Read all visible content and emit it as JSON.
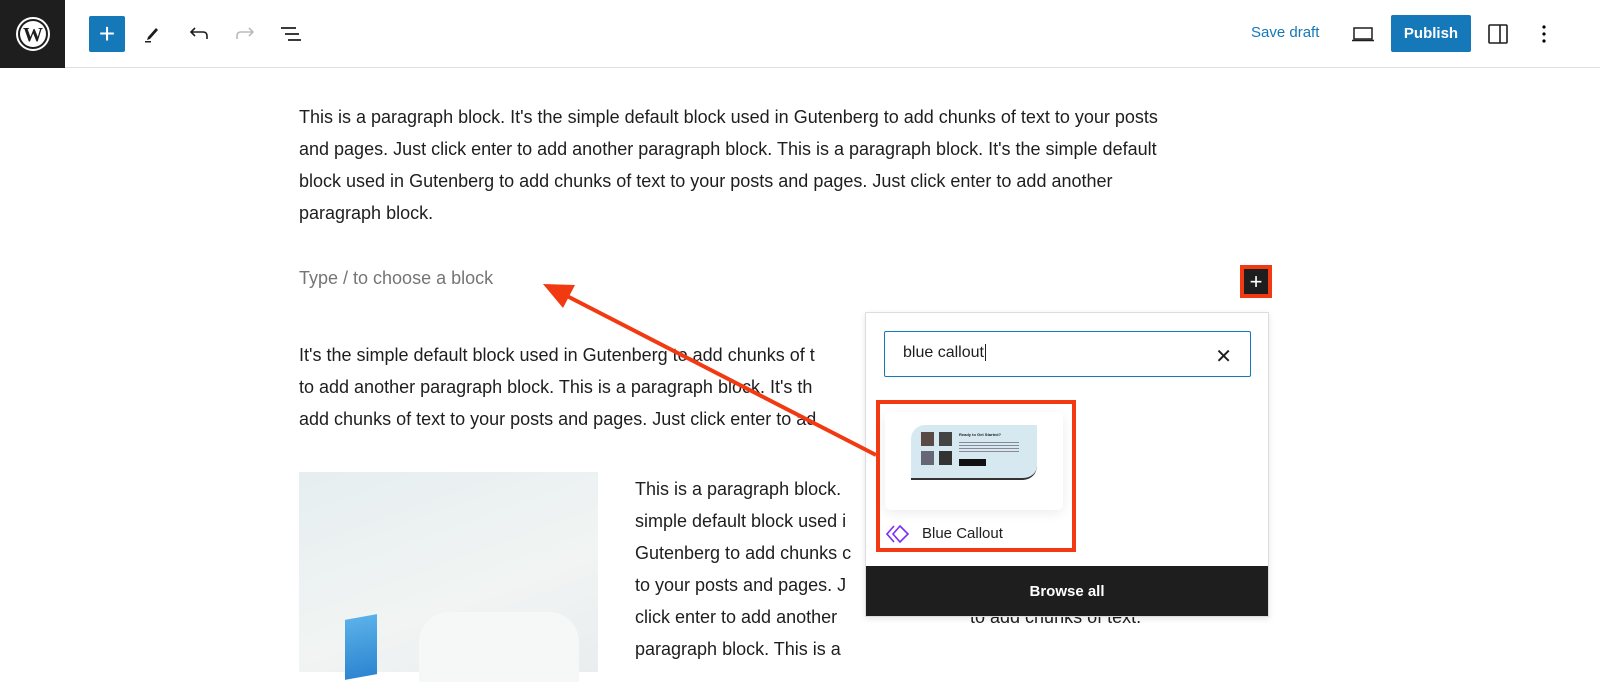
{
  "toolbar": {
    "save_draft": "Save draft",
    "publish": "Publish",
    "icons": [
      "wordpress-logo",
      "plus-icon",
      "pencil-icon",
      "undo-icon",
      "redo-icon",
      "list-view-icon",
      "laptop-preview-icon",
      "sidebar-icon",
      "more-vertical-icon"
    ]
  },
  "content": {
    "p1": [
      "This is a paragraph block. It's the simple default block used in Gutenberg to add chunks of text to your posts",
      "and pages. Just click enter to add another paragraph block. This is a paragraph block. It's the simple default",
      "block used in Gutenberg to add chunks of text to your posts and pages. Just click enter to add another",
      "paragraph block."
    ],
    "placeholder": "Type / to choose a block",
    "p2": [
      "It's the simple default block used in Gutenberg to add chunks of t",
      "to add another paragraph block. This is a paragraph block. It's th",
      "add chunks of text to your posts and pages. Just click enter to ad"
    ],
    "col_left": [
      "This is a paragraph block.",
      "simple default block used i",
      "Gutenberg to add chunks c",
      "to your posts and pages. J",
      "click enter to add another",
      "paragraph block. This is a"
    ],
    "col_right": "to add chunks of text."
  },
  "inserter": {
    "search_value": "blue callout",
    "result_label": "Blue Callout",
    "preview_title": "Ready to Get Started?",
    "browse_all": "Browse all"
  },
  "colors": {
    "accent": "#1478b9",
    "highlight": "#f23a12",
    "pattern_icon": "#7b2cf5"
  }
}
